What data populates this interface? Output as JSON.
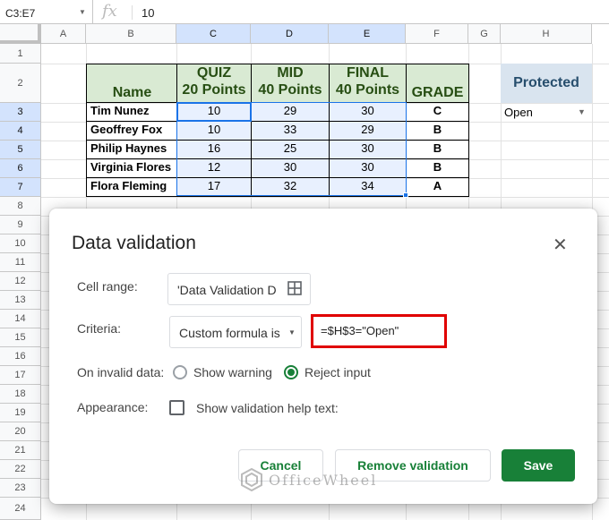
{
  "formula_bar": {
    "name_box": "C3:E7",
    "fx": "fx",
    "value": "10"
  },
  "columns": [
    "A",
    "B",
    "C",
    "D",
    "E",
    "F",
    "G",
    "H"
  ],
  "rows": [
    "1",
    "2",
    "3",
    "4",
    "5",
    "6",
    "7",
    "8",
    "9",
    "10",
    "11",
    "12",
    "13",
    "14",
    "15",
    "16",
    "17",
    "18",
    "19",
    "20",
    "21",
    "22",
    "23",
    "24"
  ],
  "table": {
    "headers": {
      "name": "Name",
      "quiz_1": "QUIZ",
      "quiz_2": "20 Points",
      "mid_1": "MID",
      "mid_2": "40 Points",
      "final_1": "FINAL",
      "final_2": "40 Points",
      "grade": "GRADE"
    },
    "rows": [
      {
        "name": "Tim Nunez",
        "quiz": "10",
        "mid": "29",
        "final": "30",
        "grade": "C"
      },
      {
        "name": "Geoffrey Fox",
        "quiz": "10",
        "mid": "33",
        "final": "29",
        "grade": "B"
      },
      {
        "name": "Philip Haynes",
        "quiz": "16",
        "mid": "25",
        "final": "30",
        "grade": "B"
      },
      {
        "name": "Virginia Flores",
        "quiz": "12",
        "mid": "30",
        "final": "30",
        "grade": "B"
      },
      {
        "name": "Flora Fleming",
        "quiz": "17",
        "mid": "32",
        "final": "34",
        "grade": "A"
      }
    ]
  },
  "protected": {
    "label": "Protected",
    "value": "Open"
  },
  "dialog": {
    "title": "Data validation",
    "cell_range_label": "Cell range:",
    "cell_range_value": "'Data Validation D",
    "criteria_label": "Criteria:",
    "criteria_value": "Custom formula is",
    "formula": "=$H$3=\"Open\"",
    "invalid_label": "On invalid data:",
    "show_warning": "Show warning",
    "reject_input": "Reject input",
    "appearance_label": "Appearance:",
    "help_text_label": "Show validation help text:",
    "cancel": "Cancel",
    "remove": "Remove validation",
    "save": "Save"
  },
  "watermark": "OfficeWheel",
  "colors": {
    "accent_green": "#188038",
    "header_green": "#d9ead3",
    "selection_blue": "#1a73e8",
    "highlight_red": "#e00000"
  }
}
